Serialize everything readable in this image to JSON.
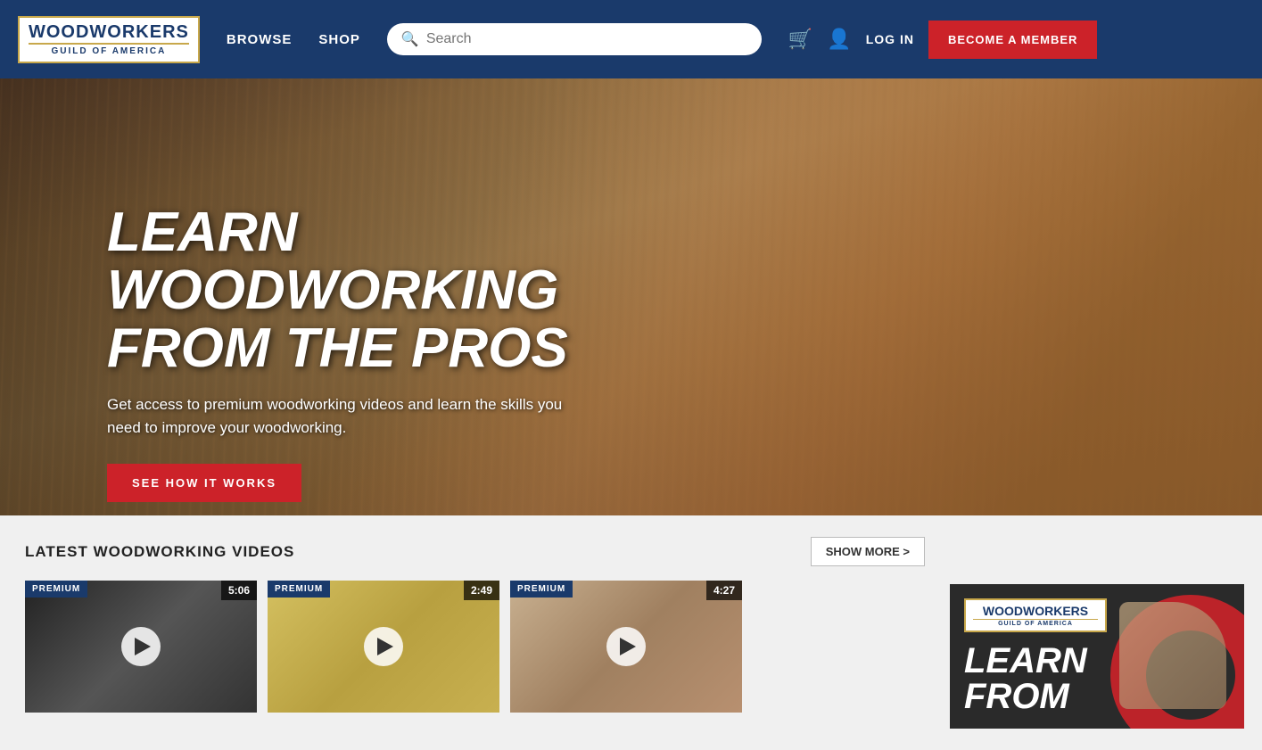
{
  "header": {
    "logo": {
      "top_line": "WOODWORKERS",
      "bottom_line": "GUILD OF AMERICA"
    },
    "nav": {
      "browse_label": "BROWSE",
      "shop_label": "SHOP"
    },
    "search": {
      "placeholder": "Search"
    },
    "login_label": "LOG IN",
    "become_member_label": "BECOME A MEMBER"
  },
  "hero": {
    "title_line1": "LEARN WOODWORKING",
    "title_line2": "FROM THE PROS",
    "subtitle": "Get access to premium woodworking videos and learn  the skills you need to improve your woodworking.",
    "cta_label": "SEE HOW IT WORKS"
  },
  "lower": {
    "videos_section_title": "LATEST WOODWORKING VIDEOS",
    "show_more_label": "SHOW MORE >",
    "videos": [
      {
        "badge": "PREMIUM",
        "duration": "5:06",
        "bg_class": "video-card-bg-1"
      },
      {
        "badge": "PREMIUM",
        "duration": "2:49",
        "bg_class": "video-card-bg-2"
      },
      {
        "badge": "PREMIUM",
        "duration": "4:27",
        "bg_class": "video-card-bg-3"
      }
    ],
    "side_ad": {
      "logo_top": "WOODWORKERS",
      "logo_divider": true,
      "logo_bottom": "GUILD OF AMERICA",
      "text_line1": "LEARN",
      "text_line2": "FROM"
    }
  }
}
